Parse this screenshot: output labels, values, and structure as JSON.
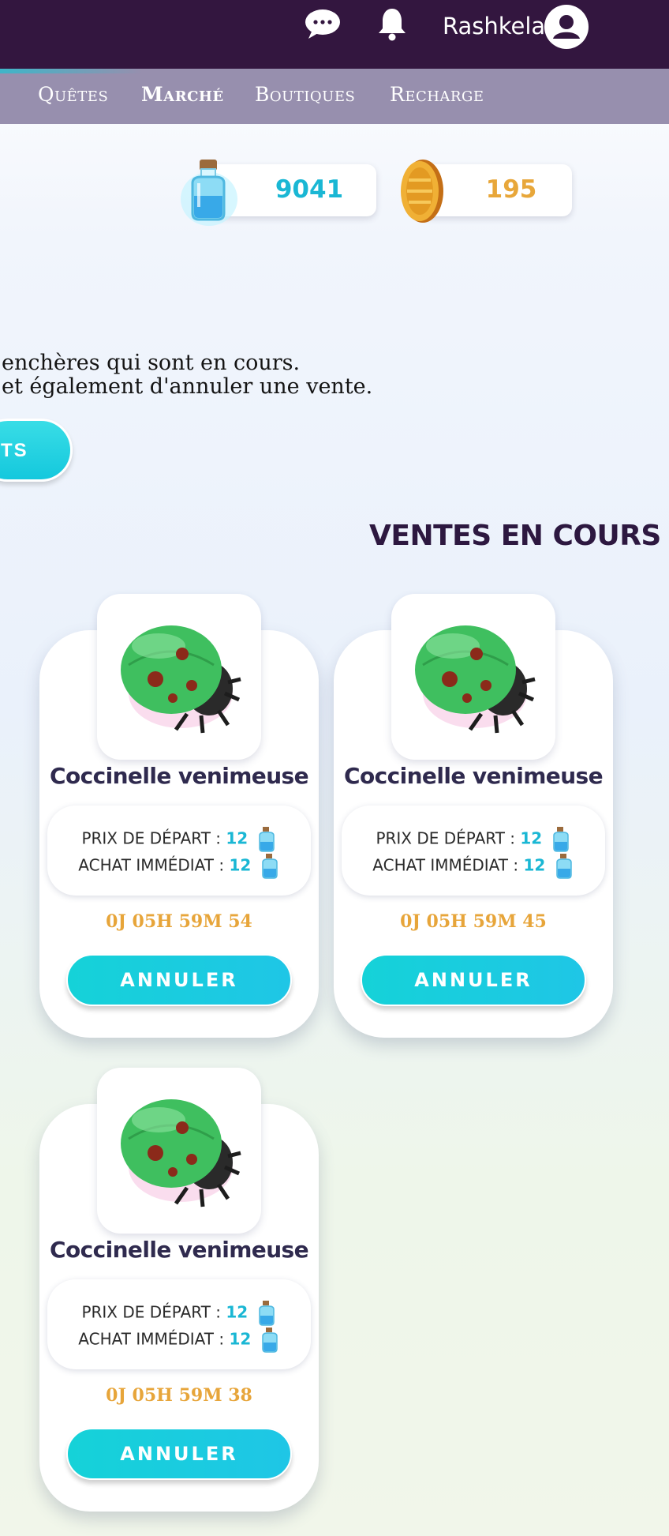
{
  "header": {
    "username": "Rashkela",
    "icons": [
      "chat-icon",
      "bell-icon",
      "avatar-icon"
    ]
  },
  "nav": {
    "items": [
      "Quêtes",
      "Marché",
      "Boutiques",
      "Recharge"
    ],
    "active": "Marché"
  },
  "currencies": {
    "potions": "9041",
    "coins": "195"
  },
  "description": {
    "line1": "enchères qui sont en cours.",
    "line2": "et également d'annuler une vente."
  },
  "cut_button_label": "TS",
  "section_title": "VENTES EN COURS",
  "listings": [
    {
      "name": "Coccinelle venimeuse",
      "start_label": "PRIX DE DÉPART :",
      "start_price": "12",
      "buy_label": "ACHAT IMMÉDIAT :",
      "buy_price": "12",
      "timer": "0J 05H 59M 54",
      "cancel_label": "ANNULER"
    },
    {
      "name": "Coccinelle venimeuse",
      "start_label": "PRIX DE DÉPART :",
      "start_price": "12",
      "buy_label": "ACHAT IMMÉDIAT :",
      "buy_price": "12",
      "timer": "0J 05H 59M 45",
      "cancel_label": "ANNULER"
    },
    {
      "name": "Coccinelle venimeuse",
      "start_label": "PRIX DE DÉPART :",
      "start_price": "12",
      "buy_label": "ACHAT IMMÉDIAT :",
      "buy_price": "12",
      "timer": "0J 05H 59M 38",
      "cancel_label": "ANNULER"
    }
  ],
  "colors": {
    "topbar": "#33163f",
    "subnav": "#978fae",
    "accent_cyan": "#1ab7d4",
    "timer_orange": "#e7a53a",
    "coin_gold": "#e8a73a"
  }
}
